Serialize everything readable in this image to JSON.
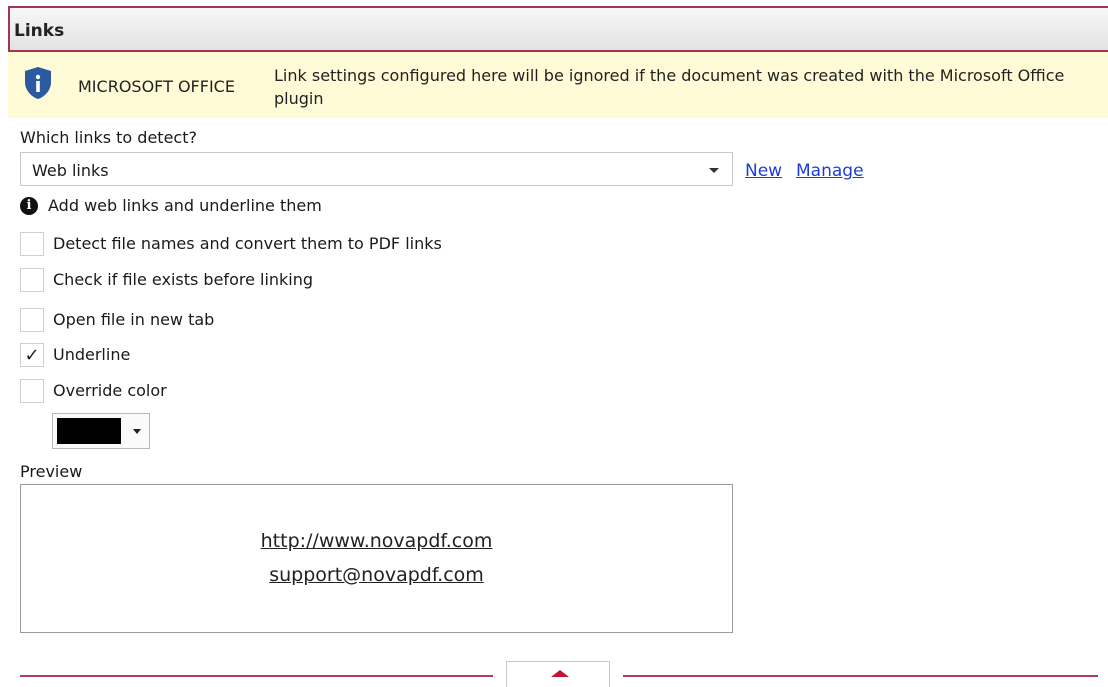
{
  "header": {
    "title": "Links"
  },
  "notice": {
    "label": "MICROSOFT OFFICE",
    "text": "Link settings configured here will be ignored if the document was created with the Microsoft Office plugin"
  },
  "detect": {
    "label": "Which links to detect?",
    "selected": "Web links",
    "new_label": "New",
    "manage_label": "Manage",
    "info_text": "Add web links and underline them"
  },
  "options": [
    {
      "label": "Detect file names and convert them to PDF links",
      "checked": false
    },
    {
      "label": "Check if file exists before linking",
      "checked": false
    },
    {
      "label": "Open file in new tab",
      "checked": false
    },
    {
      "label": "Underline",
      "checked": true
    },
    {
      "label": "Override color",
      "checked": false
    }
  ],
  "color": {
    "value": "#000000"
  },
  "preview": {
    "label": "Preview",
    "lines": [
      "http://www.novapdf.com",
      "support@novapdf.com"
    ]
  },
  "colors": {
    "accent": "#a3354e",
    "link": "#1f3dd6",
    "notice_bg": "#fffbd6",
    "shield": "#2b5aa0"
  }
}
